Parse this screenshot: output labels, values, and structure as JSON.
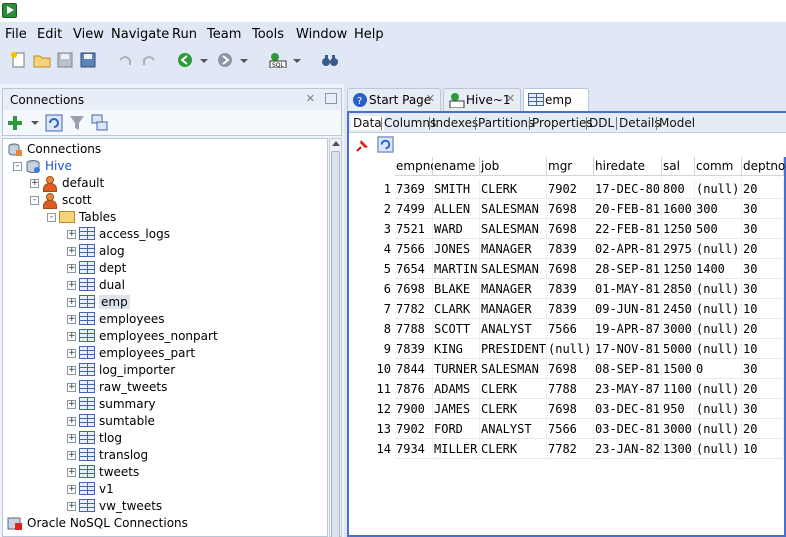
{
  "menu": [
    "File",
    "Edit",
    "View",
    "Navigate",
    "Run",
    "Team",
    "Tools",
    "Window",
    "Help"
  ],
  "menu_underline": [
    "F",
    "E",
    "V",
    "N",
    "R",
    "m",
    "T",
    "W",
    "H"
  ],
  "connections_panel": {
    "title": "Connections",
    "tree": [
      {
        "label": "Connections",
        "level": 0,
        "icon": "connections-icon",
        "exp": ""
      },
      {
        "label": "Hive",
        "level": 1,
        "icon": "database-icon",
        "exp": "-",
        "color": "#1a4fd6"
      },
      {
        "label": "default",
        "level": 2,
        "icon": "user-icon",
        "exp": "+"
      },
      {
        "label": "scott",
        "level": 2,
        "icon": "user-icon",
        "exp": "-"
      },
      {
        "label": "Tables",
        "level": 3,
        "icon": "folder-icon",
        "exp": "-"
      },
      {
        "label": "access_logs",
        "level": 4,
        "icon": "table-icon",
        "exp": "+"
      },
      {
        "label": "alog",
        "level": 4,
        "icon": "table-icon",
        "exp": "+"
      },
      {
        "label": "dept",
        "level": 4,
        "icon": "table-icon",
        "exp": "+"
      },
      {
        "label": "dual",
        "level": 4,
        "icon": "table-icon",
        "exp": "+"
      },
      {
        "label": "emp",
        "level": 4,
        "icon": "table-icon",
        "exp": "+",
        "selected": true
      },
      {
        "label": "employees",
        "level": 4,
        "icon": "table-icon",
        "exp": "+"
      },
      {
        "label": "employees_nonpart",
        "level": 4,
        "icon": "table-icon",
        "exp": "+"
      },
      {
        "label": "employees_part",
        "level": 4,
        "icon": "table-icon",
        "exp": "+"
      },
      {
        "label": "log_importer",
        "level": 4,
        "icon": "table-icon",
        "exp": "+"
      },
      {
        "label": "raw_tweets",
        "level": 4,
        "icon": "table-icon",
        "exp": "+"
      },
      {
        "label": "summary",
        "level": 4,
        "icon": "table-icon",
        "exp": "+"
      },
      {
        "label": "sumtable",
        "level": 4,
        "icon": "table-icon",
        "exp": "+"
      },
      {
        "label": "tlog",
        "level": 4,
        "icon": "table-icon",
        "exp": "+"
      },
      {
        "label": "translog",
        "level": 4,
        "icon": "table-icon",
        "exp": "+"
      },
      {
        "label": "tweets",
        "level": 4,
        "icon": "table-icon",
        "exp": "+"
      },
      {
        "label": "v1",
        "level": 4,
        "icon": "table-icon",
        "exp": "+"
      },
      {
        "label": "vw_tweets",
        "level": 4,
        "icon": "table-icon",
        "exp": "+"
      },
      {
        "label": "Oracle NoSQL Connections",
        "level": 0,
        "icon": "nosql-icon",
        "exp": ""
      }
    ]
  },
  "doc_tabs": [
    {
      "label": "Start Page",
      "icon": "help-icon"
    },
    {
      "label": "Hive~1",
      "icon": "sql-worksheet-icon"
    },
    {
      "label": "emp",
      "icon": "table-icon",
      "active": true
    }
  ],
  "sub_tabs": [
    "Data",
    "Columns",
    "Indexes",
    "Partitions",
    "Properties",
    "DDL",
    "Details",
    "Model"
  ],
  "active_sub_tab": "Data",
  "grid": {
    "columns": [
      "empno",
      "ename",
      "job",
      "mgr",
      "hiredate",
      "sal",
      "comm",
      "deptno"
    ],
    "rows": [
      [
        "7369",
        "SMITH",
        "CLERK",
        "7902",
        "17-DEC-80",
        "800",
        "(null)",
        "20"
      ],
      [
        "7499",
        "ALLEN",
        "SALESMAN",
        "7698",
        "20-FEB-81",
        "1600",
        "300",
        "30"
      ],
      [
        "7521",
        "WARD",
        "SALESMAN",
        "7698",
        "22-FEB-81",
        "1250",
        "500",
        "30"
      ],
      [
        "7566",
        "JONES",
        "MANAGER",
        "7839",
        "02-APR-81",
        "2975",
        "(null)",
        "20"
      ],
      [
        "7654",
        "MARTIN",
        "SALESMAN",
        "7698",
        "28-SEP-81",
        "1250",
        "1400",
        "30"
      ],
      [
        "7698",
        "BLAKE",
        "MANAGER",
        "7839",
        "01-MAY-81",
        "2850",
        "(null)",
        "30"
      ],
      [
        "7782",
        "CLARK",
        "MANAGER",
        "7839",
        "09-JUN-81",
        "2450",
        "(null)",
        "10"
      ],
      [
        "7788",
        "SCOTT",
        "ANALYST",
        "7566",
        "19-APR-87",
        "3000",
        "(null)",
        "20"
      ],
      [
        "7839",
        "KING",
        "PRESIDENT",
        "(null)",
        "17-NOV-81",
        "5000",
        "(null)",
        "10"
      ],
      [
        "7844",
        "TURNER",
        "SALESMAN",
        "7698",
        "08-SEP-81",
        "1500",
        "0",
        "30"
      ],
      [
        "7876",
        "ADAMS",
        "CLERK",
        "7788",
        "23-MAY-87",
        "1100",
        "(null)",
        "20"
      ],
      [
        "7900",
        "JAMES",
        "CLERK",
        "7698",
        "03-DEC-81",
        "950",
        "(null)",
        "30"
      ],
      [
        "7902",
        "FORD",
        "ANALYST",
        "7566",
        "03-DEC-81",
        "3000",
        "(null)",
        "20"
      ],
      [
        "7934",
        "MILLER",
        "CLERK",
        "7782",
        "23-JAN-82",
        "1300",
        "(null)",
        "10"
      ]
    ],
    "row_numbers": [
      "1",
      "2",
      "3",
      "4",
      "5",
      "6",
      "7",
      "8",
      "9",
      "10",
      "11",
      "12",
      "13",
      "14"
    ]
  },
  "colors": {
    "accent": "#4a6fd0",
    "selected_row": "#dbe6f7",
    "hive_link": "#1a4fd6"
  }
}
